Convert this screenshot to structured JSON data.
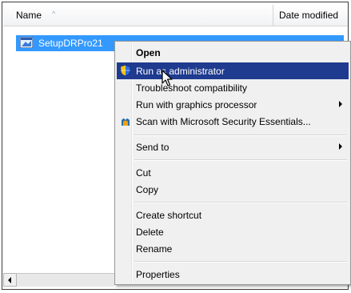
{
  "columns": {
    "name_label": "Name",
    "name_sort_glyph": "^",
    "date_label": "Date modified"
  },
  "file": {
    "name": "SetupDRPro21",
    "icon": "installer-icon"
  },
  "context_menu": {
    "open": "Open",
    "run_as_admin": "Run as administrator",
    "troubleshoot": "Troubleshoot compatibility",
    "run_with_gpu": "Run with graphics processor",
    "scan_mse": "Scan with Microsoft Security Essentials...",
    "send_to": "Send to",
    "cut": "Cut",
    "copy": "Copy",
    "create_shortcut": "Create shortcut",
    "delete": "Delete",
    "rename": "Rename",
    "properties": "Properties"
  },
  "colors": {
    "selection": "#3399ff",
    "menu_background": "#f0f0f0",
    "menu_highlight": "#1f3b8f"
  }
}
